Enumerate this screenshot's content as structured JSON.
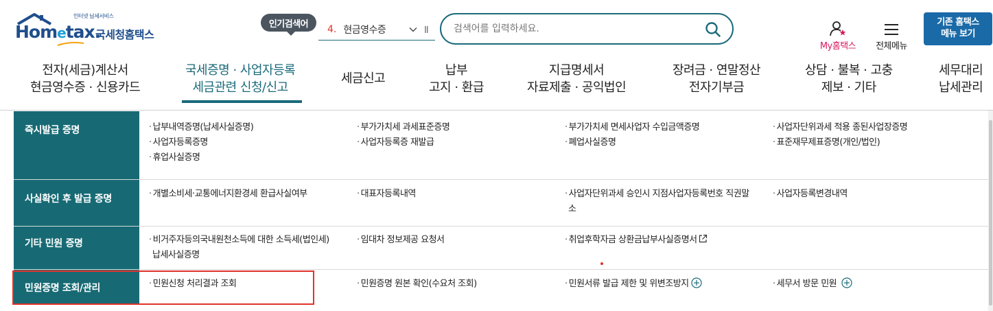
{
  "header": {
    "logo_small": "인터넷 납세서비스",
    "logo_main_a": "Hom",
    "logo_main_e": "e",
    "logo_main_b": "tax.",
    "logo_sub": "국세청홈택스",
    "popular_badge": "인기검색어",
    "popular_rank": "4.",
    "popular_keyword": "현금영수증",
    "popular_pause": "II",
    "search_placeholder": "검색어를 입력하세요.",
    "myhome_label": "My홈택스",
    "allmenu_label": "전체메뉴",
    "old_btn_line1": "기존 홈택스",
    "old_btn_line2": "메뉴 보기"
  },
  "gnb": [
    {
      "line1": "전자(세금)계산서",
      "line2": "현금영수증 · 신용카드"
    },
    {
      "line1": "국세증명 · 사업자등록",
      "line2": "세금관련 신청/신고"
    },
    {
      "line1": "세금신고",
      "line2": ""
    },
    {
      "line1": "납부",
      "line2": "고지 · 환급"
    },
    {
      "line1": "지급명세서",
      "line2": "자료제출 · 공익법인"
    },
    {
      "line1": "장려금 · 연말정산",
      "line2": "전자기부금"
    },
    {
      "line1": "상담 · 불복 · 고충",
      "line2": "제보 · 기타"
    },
    {
      "line1": "세무대리",
      "line2": "납세관리"
    }
  ],
  "rows": [
    {
      "title": "즉시발급 증명",
      "cells": [
        [
          "납부내역증명(납세사실증명)",
          "사업자등록증명",
          "휴업사실증명"
        ],
        [
          "부가가치세 과세표준증명",
          "사업자등록증 재발급"
        ],
        [
          "부가가치세 면세사업자 수입금액증명",
          "폐업사실증명"
        ],
        [
          "사업자단위과세 적용 종된사업장증명",
          "표준재무제표증명(개인/법인)"
        ]
      ]
    },
    {
      "title": "사실확인 후 발급 증명",
      "cells": [
        [
          "개별소비세·교통에너지환경세 환급사실여부"
        ],
        [
          "대표자등록내역"
        ],
        [
          "사업자단위과세 승인시 지점사업자등록번호 직권말",
          "소"
        ],
        [
          "사업자등록변경내역"
        ]
      ]
    },
    {
      "title": "기타 민원 증명",
      "cells": [
        [
          "비거주자등의국내원천소득에 대한 소득세(법인세)",
          "납세사실증명"
        ],
        [
          "임대차 정보제공 요청서"
        ],
        [
          "취업후학자금 상환금납부사실증명서"
        ],
        []
      ]
    },
    {
      "title": "민원증명 조회/관리",
      "cells": [
        [
          "민원신청 처리결과 조회"
        ],
        [
          "민원증명 원본 확인(수요처 조회)"
        ],
        [
          "민원서류 발급 제한 및 위변조방지"
        ],
        [
          "세무서 방문 민원"
        ]
      ]
    }
  ],
  "bullet": "·",
  "colors": {
    "teal": "#176a74",
    "primary_button": "#1a6aa8",
    "highlight_red": "#e0332b",
    "myhome_pink": "#d81b60"
  }
}
